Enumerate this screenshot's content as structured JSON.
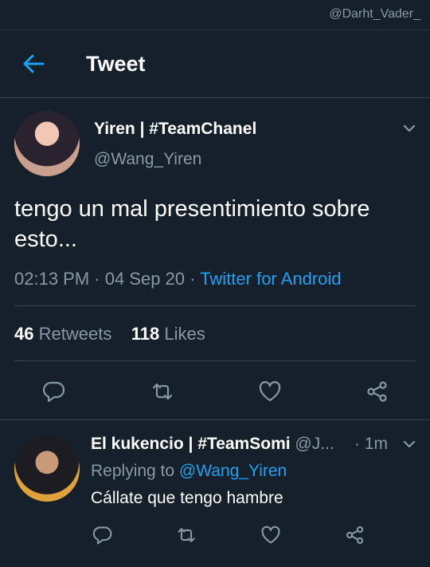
{
  "watermark": "@Darht_Vader_",
  "header": {
    "title": "Tweet",
    "back_icon": "arrow-left-icon"
  },
  "colors": {
    "background": "#15202b",
    "accent": "#1da1f2",
    "muted": "#8899a6",
    "divider": "#38444d"
  },
  "tweet": {
    "author_name": "Yiren | #TeamChanel",
    "author_handle": "@Wang_Yiren",
    "text": "tengo un mal presentimiento sobre esto...",
    "time": "02:13 PM · 04 Sep 20 ·",
    "source": "Twitter for Android",
    "retweets_count": "46",
    "retweets_label": "Retweets",
    "likes_count": "118",
    "likes_label": "Likes",
    "actions": [
      "reply-icon",
      "retweet-icon",
      "like-icon",
      "share-icon"
    ]
  },
  "reply": {
    "author_name": "El kukencio | #TeamSomi",
    "author_handle": "@J...",
    "time": "· 1m",
    "replying_label": "Replying to",
    "replying_to": "@Wang_Yiren",
    "text": "Cállate que tengo hambre",
    "actions": [
      "reply-icon",
      "retweet-icon",
      "like-icon",
      "share-icon"
    ]
  }
}
